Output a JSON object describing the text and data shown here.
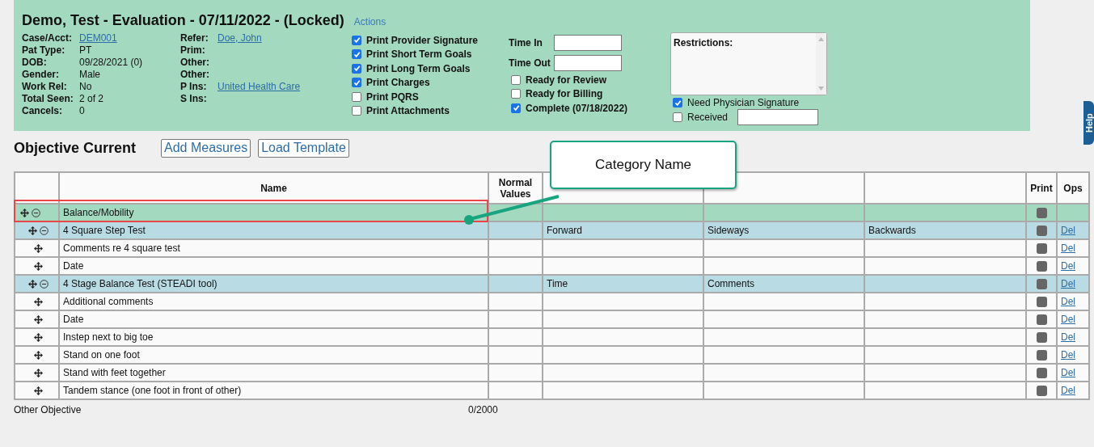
{
  "header": {
    "title": "Demo, Test - Evaluation - 07/11/2022 - (Locked)",
    "actions": "Actions",
    "info_left": [
      {
        "label": "Case/Acct:",
        "value": "DEM001",
        "kind": "link"
      },
      {
        "label": "Pat Type:",
        "value": "PT",
        "kind": "text"
      },
      {
        "label": "DOB:",
        "value": "09/28/2021 (0)",
        "kind": "text"
      },
      {
        "label": "Gender:",
        "value": "Male",
        "kind": "text"
      },
      {
        "label": "Work Rel:",
        "value": "No",
        "kind": "text"
      },
      {
        "label": "Total Seen:",
        "value": "2 of 2",
        "kind": "text"
      },
      {
        "label": "Cancels:",
        "value": "0",
        "kind": "text"
      }
    ],
    "info_right": [
      {
        "label": "Refer:",
        "value": "Doe, John",
        "kind": "link"
      },
      {
        "label": "Prim:"
      },
      {
        "label": "Other:"
      },
      {
        "label": "Other:"
      },
      {
        "label": "P Ins:",
        "value": "United Health Care",
        "kind": "link"
      },
      {
        "label": "S Ins:"
      }
    ],
    "print_options": [
      {
        "label": "Print Provider Signature",
        "checked": true
      },
      {
        "label": "Print Short Term Goals",
        "checked": true
      },
      {
        "label": "Print Long Term Goals",
        "checked": true
      },
      {
        "label": "Print Charges",
        "checked": true
      },
      {
        "label": "Print PQRS",
        "checked": false
      },
      {
        "label": "Print Attachments",
        "checked": false
      }
    ],
    "time_fields": [
      {
        "label": "Time In"
      },
      {
        "label": "Time Out"
      }
    ],
    "status_options": [
      {
        "label": "Ready for Review",
        "checked": false
      },
      {
        "label": "Ready for Billing",
        "checked": false
      },
      {
        "label": "Complete (07/18/2022)",
        "checked": true
      }
    ],
    "restrictions": {
      "label": "Restrictions:"
    },
    "signature_options": [
      {
        "label": "Need Physician Signature",
        "checked": true,
        "kind": "plain"
      },
      {
        "label": "Received",
        "checked": false,
        "kind": "field"
      }
    ]
  },
  "help_tab": "Help",
  "section": {
    "title": "Objective Current",
    "buttons": [
      "Add Measures",
      "Load Template"
    ]
  },
  "callout": {
    "text": "Category Name"
  },
  "table": {
    "columns": [
      "",
      "Name",
      "Normal Values",
      "",
      "",
      "",
      "Print",
      "Ops"
    ],
    "rows": [
      {
        "kind": "category",
        "name": "Balance/Mobility",
        "expanded": true,
        "highlighted": true,
        "children": [
          {
            "kind": "test",
            "name": "4 Square Step Test",
            "expanded": true,
            "cells": [
              "Forward",
              "Sideways",
              "Backwards"
            ],
            "op": "Del",
            "children": [
              {
                "kind": "item",
                "name": "Comments re 4 square test",
                "op": "Del"
              },
              {
                "kind": "item",
                "name": "Date",
                "op": "Del"
              }
            ]
          },
          {
            "kind": "test",
            "name": "4 Stage Balance Test (STEADI tool)",
            "expanded": true,
            "cells": [
              "Time",
              "Comments"
            ],
            "op": "Del",
            "children": [
              {
                "kind": "item",
                "name": "Additional comments",
                "op": "Del"
              },
              {
                "kind": "item",
                "name": "Date",
                "op": "Del"
              },
              {
                "kind": "item",
                "name": "Instep next to big toe",
                "op": "Del"
              },
              {
                "kind": "item",
                "name": "Stand on one foot",
                "op": "Del"
              },
              {
                "kind": "item",
                "name": "Stand with feet together",
                "op": "Del"
              },
              {
                "kind": "item",
                "name": "Tandem stance (one foot in front of other)",
                "op": "Del"
              }
            ]
          }
        ]
      }
    ]
  },
  "footer": {
    "label": "Other Objective",
    "count": "0/2000"
  }
}
